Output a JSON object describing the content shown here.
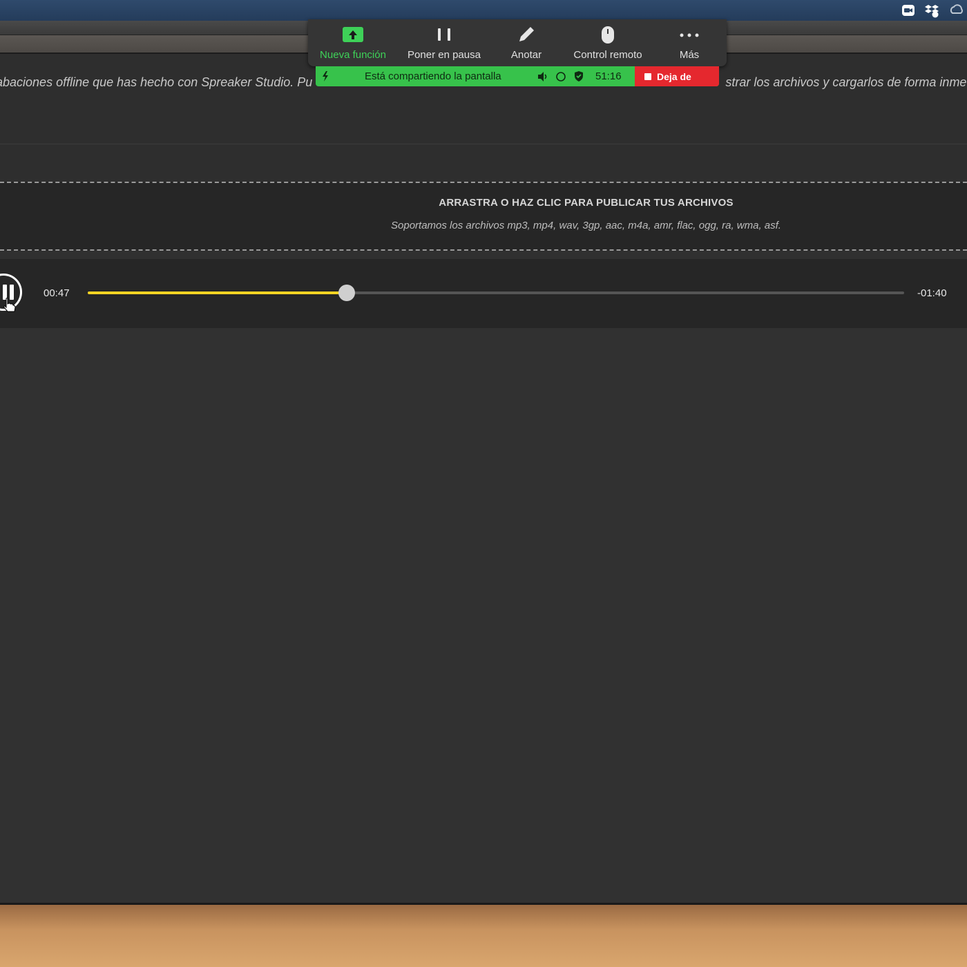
{
  "menubar": {
    "tray_icons": [
      "zoom-icon",
      "dropbox-icon",
      "creative-cloud-icon"
    ]
  },
  "intro": {
    "text": "abaciones offline que has hecho con Spreaker Studio. Pu",
    "text_right": "strar los archivos y cargarlos de forma inmed"
  },
  "dropzone": {
    "title": "ARRASTRA O HAZ CLIC PARA PUBLICAR TUS ARCHIVOS",
    "subtitle": "Soportamos los archivos mp3, mp4, wav, 3gp, aac, m4a, amr, flac, ogg, ra, wma, asf."
  },
  "player": {
    "elapsed": "00:47",
    "remaining": "-01:40",
    "progress": 0.317,
    "progress_color": "#f5d423"
  },
  "zoom_toolbar": {
    "items": [
      {
        "label": "Nueva función",
        "icon": "share-screen-icon",
        "color": "#3ed158"
      },
      {
        "label": "Poner en pausa",
        "icon": "pause-icon"
      },
      {
        "label": "Anotar",
        "icon": "pencil-icon"
      },
      {
        "label": "Control remoto",
        "icon": "mouse-icon"
      },
      {
        "label": "Más",
        "icon": "more-icon"
      }
    ],
    "share_status": "Está compartiendo la pantalla",
    "timer": "51:16",
    "stop_label": "Deja de",
    "share_color": "#37c24b",
    "stop_color": "#e5282e"
  }
}
